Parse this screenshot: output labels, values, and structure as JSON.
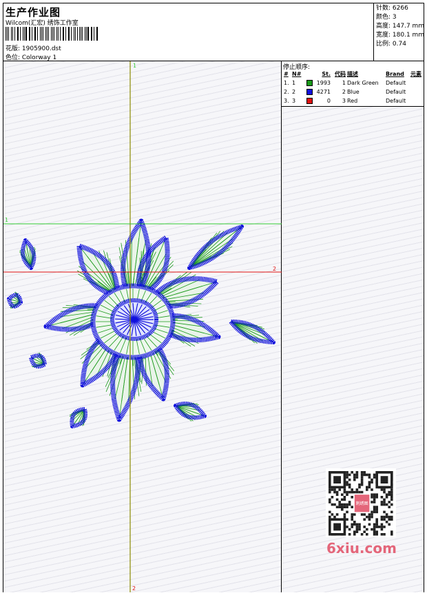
{
  "header": {
    "title": "生产作业图",
    "company": "Wilcom(汇宏) 绣饰工作室",
    "design_line": "花版:  1905900.dst",
    "color_line": "色位:  Colorway 1"
  },
  "info": [
    {
      "label": "针数",
      "value": "6266"
    },
    {
      "label": "颜色",
      "value": "3"
    },
    {
      "label": "高度",
      "value": "147.7 mm"
    },
    {
      "label": "宽度",
      "value": "180.1 mm"
    },
    {
      "label": "比例",
      "value": "0.74"
    }
  ],
  "sequence": {
    "title": "停止顺序:",
    "headers": [
      "#",
      "N#",
      "St.",
      "代码",
      "描述",
      "Brand",
      "元素"
    ],
    "rows": [
      {
        "index": "1.",
        "n": "1",
        "color": "#1a9a1a",
        "stitches": "1993",
        "code": "1",
        "desc": "Dark Green",
        "brand": "Default"
      },
      {
        "index": "2.",
        "n": "2",
        "color": "#1111dd",
        "stitches": "4271",
        "code": "2",
        "desc": "Blue",
        "brand": "Default"
      },
      {
        "index": "3.",
        "n": "3",
        "color": "#e01111",
        "stitches": "0",
        "code": "3",
        "desc": "Red",
        "brand": "Default"
      }
    ]
  },
  "guides": {
    "vertical_top": "1",
    "vertical_bottom": "2",
    "horizontal_green": "1",
    "horizontal_red": "2"
  },
  "thread_colors": {
    "green": "#1a9a1a",
    "blue": "#1111dd",
    "red": "#e01111",
    "guide_olive": "#8a8a00",
    "guide_green": "#33cc33"
  },
  "watermark": {
    "text": "6xiu.com",
    "seal": "刺绣图"
  }
}
